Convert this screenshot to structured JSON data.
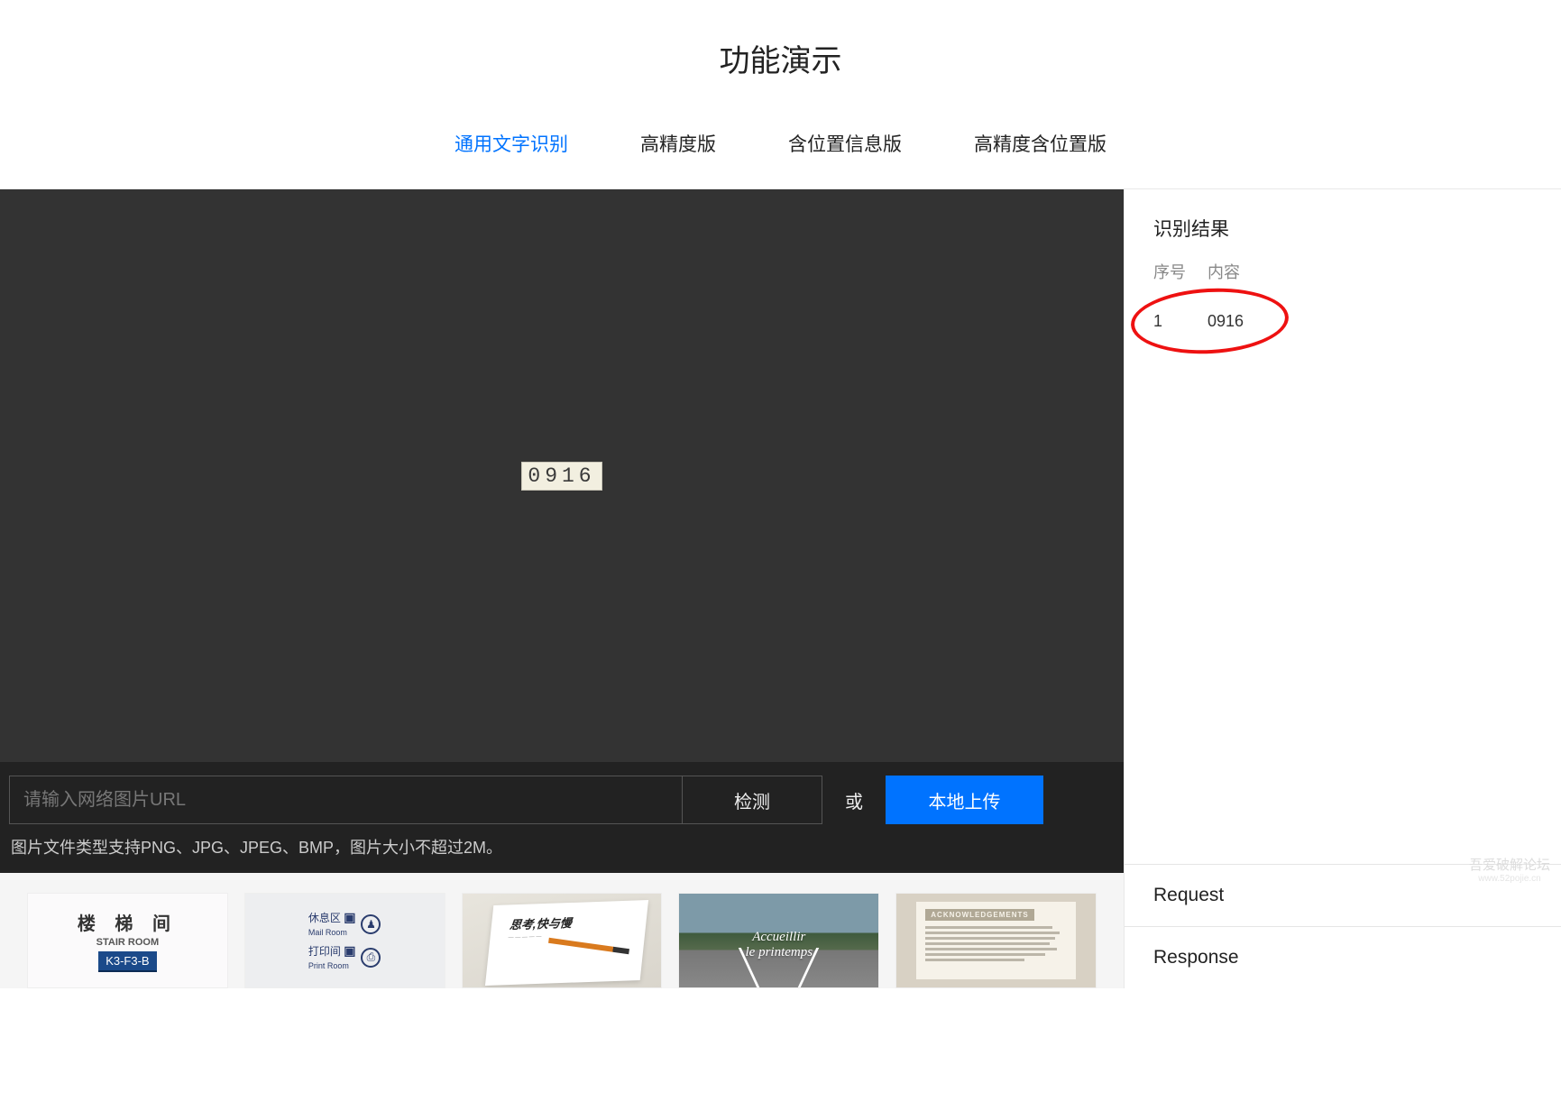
{
  "page_title": "功能演示",
  "tabs": [
    {
      "label": "通用文字识别",
      "active": true
    },
    {
      "label": "高精度版",
      "active": false
    },
    {
      "label": "含位置信息版",
      "active": false
    },
    {
      "label": "高精度含位置版",
      "active": false
    }
  ],
  "preview": {
    "captcha_text": "0916"
  },
  "url_bar": {
    "placeholder": "请输入网络图片URL",
    "detect_label": "检测",
    "or_label": "或",
    "upload_label": "本地上传"
  },
  "hint_text": "图片文件类型支持PNG、JPG、JPEG、BMP，图片大小不超过2M。",
  "thumbs": {
    "t1": {
      "cn": "楼 梯 间",
      "en": "STAIR ROOM",
      "badge": "K3-F3-B"
    },
    "t2": {
      "row1_label": "休息区",
      "row1_sub": "Mail Room",
      "row2_label": "打印间",
      "row2_sub": "Print Room"
    },
    "t3": {
      "title": "思考,快与慢",
      "sub": "— — — — —"
    },
    "t4": {
      "line1": "Accueillir",
      "line2": "le printemps"
    },
    "t5": {
      "heading": "ACKNOWLEDGEMENTS"
    }
  },
  "result": {
    "title": "识别结果",
    "col_index": "序号",
    "col_content": "内容",
    "rows": [
      {
        "index": "1",
        "content": "0916"
      }
    ],
    "accordion": [
      "Request",
      "Response"
    ]
  },
  "watermark": {
    "top": "吾爱破解论坛",
    "bottom": "www.52pojie.cn"
  }
}
